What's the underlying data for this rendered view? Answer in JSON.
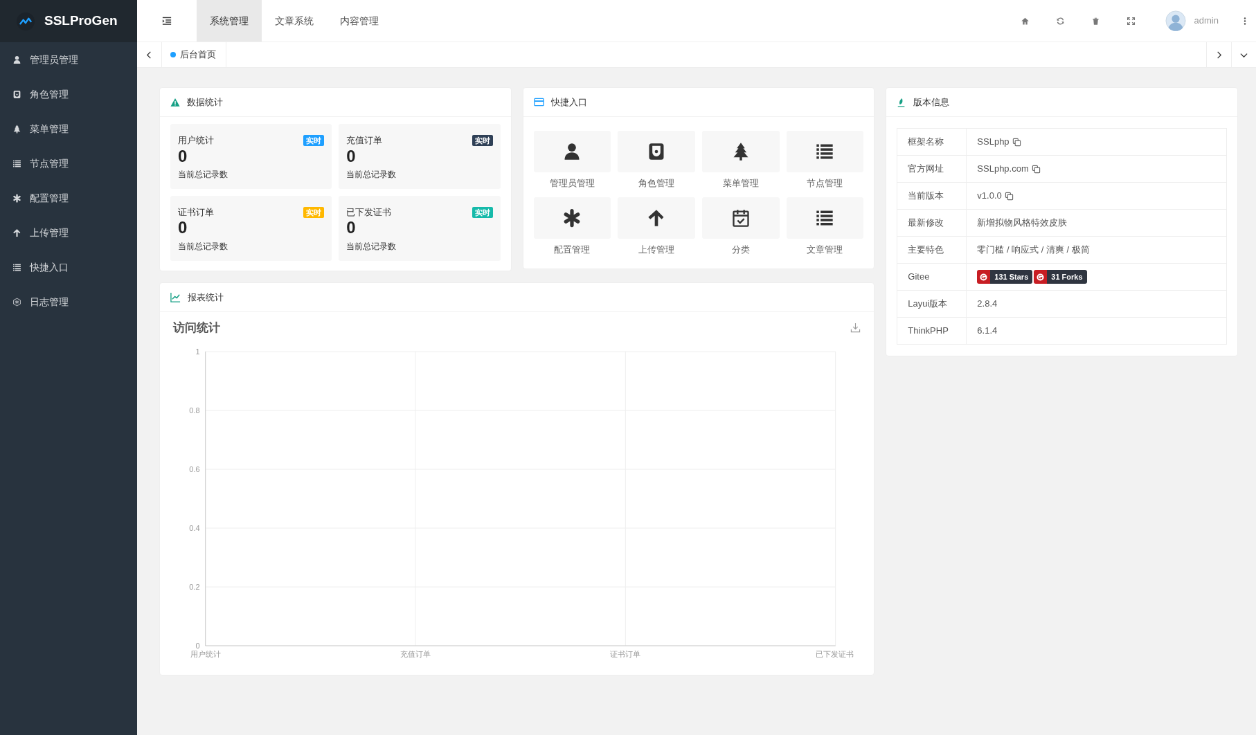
{
  "app": {
    "logo": "SSLProGen"
  },
  "sidebar": {
    "items": [
      {
        "label": "管理员管理"
      },
      {
        "label": "角色管理"
      },
      {
        "label": "菜单管理"
      },
      {
        "label": "节点管理"
      },
      {
        "label": "配置管理"
      },
      {
        "label": "上传管理"
      },
      {
        "label": "快捷入口"
      },
      {
        "label": "日志管理"
      }
    ]
  },
  "header": {
    "tabs": [
      {
        "label": "系统管理",
        "selected": true
      },
      {
        "label": "文章系统",
        "selected": false
      },
      {
        "label": "内容管理",
        "selected": false
      }
    ],
    "user": "admin"
  },
  "page_tabs": [
    {
      "label": "后台首页",
      "selected": true
    }
  ],
  "data_stats": {
    "title": "数据统计",
    "tiles": [
      {
        "label": "用户统计",
        "badge": "实时",
        "color": "#1e9fff",
        "value": "0",
        "note": "当前总记录数"
      },
      {
        "label": "充值订单",
        "badge": "实时",
        "color": "#2f4056",
        "value": "0",
        "note": "当前总记录数"
      },
      {
        "label": "证书订单",
        "badge": "实时",
        "color": "#ffb800",
        "value": "0",
        "note": "当前总记录数"
      },
      {
        "label": "已下发证书",
        "badge": "实时",
        "color": "#16baaa",
        "value": "0",
        "note": "当前总记录数"
      }
    ]
  },
  "quick_entry": {
    "title": "快捷入口",
    "items": [
      {
        "label": "管理员管理"
      },
      {
        "label": "角色管理"
      },
      {
        "label": "菜单管理"
      },
      {
        "label": "节点管理"
      },
      {
        "label": "配置管理"
      },
      {
        "label": "上传管理"
      },
      {
        "label": "分类"
      },
      {
        "label": "文章管理"
      }
    ]
  },
  "version_info": {
    "title": "版本信息",
    "rows": [
      {
        "label": "框架名称",
        "kind": "text",
        "value": "SSLphp",
        "copyable": true
      },
      {
        "label": "官方网址",
        "kind": "text",
        "value": "SSLphp.com",
        "copyable": true
      },
      {
        "label": "当前版本",
        "kind": "text",
        "value": "v1.0.0",
        "copyable": true
      },
      {
        "label": "最新修改",
        "kind": "text",
        "value": "新增拟物风格特效皮肤",
        "copyable": false
      },
      {
        "label": "主要特色",
        "kind": "text",
        "value": "零门槛 / 响应式 / 清爽 / 极简",
        "copyable": false
      },
      {
        "label": "Gitee",
        "kind": "badges",
        "badges": [
          "131 Stars",
          "31 Forks"
        ]
      },
      {
        "label": "Layui版本",
        "kind": "text",
        "value": "2.8.4",
        "copyable": false
      },
      {
        "label": "ThinkPHP",
        "kind": "text",
        "value": "6.1.4",
        "copyable": false
      }
    ]
  },
  "report": {
    "title": "报表统计",
    "chart_data": {
      "type": "line",
      "title": "访问统计",
      "categories": [
        "用户统计",
        "充值订单",
        "证书订单",
        "已下发证书"
      ],
      "ylim": [
        0,
        1
      ],
      "yticks": [
        0,
        0.2,
        0.4,
        0.6,
        0.8,
        1
      ],
      "grid": true
    }
  }
}
